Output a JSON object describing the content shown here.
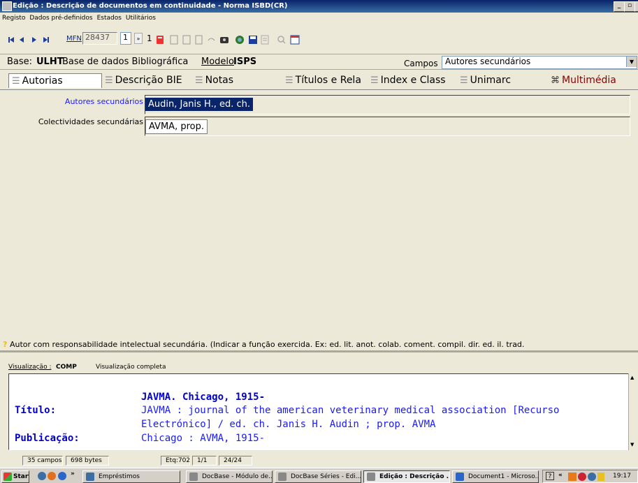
{
  "window": {
    "title": "Edição : Descrição de documentos em continuidade - Norma ISBD(CR)"
  },
  "menu": {
    "items": [
      "Registo",
      "Dados pré-definidos",
      "Estados",
      "Utilitários"
    ]
  },
  "toolbar": {
    "mfn_label": "MFN",
    "mfn_value": "28437",
    "spin_value": "1",
    "page_value": "1"
  },
  "base": {
    "label": "Base:",
    "value": "ULHT",
    "description": "Base de dados Bibliográfica",
    "modelo_label": "Modelo",
    "modelo_value": "ISPS",
    "campos_label": "Campos",
    "campos_value": "Autores secundários"
  },
  "tabs": [
    {
      "label": "Autorias"
    },
    {
      "label": "Descrição BIE"
    },
    {
      "label": "Notas"
    },
    {
      "label": "Títulos e Rela"
    },
    {
      "label": "Index e Class"
    },
    {
      "label": "Unimarc"
    },
    {
      "label": "Multimédia"
    }
  ],
  "fields": [
    {
      "label": "Autores secundários",
      "value": "Audin, Janis H., ed. ch."
    },
    {
      "label": "Colectividades secundárias",
      "value": "AVMA, prop."
    }
  ],
  "hint": {
    "icon": "?",
    "text": "Autor com responsabilidade intelectual secundária. (Indicar a função exercida. Ex: ed. lit.  anot.  colab.  coment.  compil.  dir.  ed.  il.  trad."
  },
  "visualizacao": {
    "label": "Visualização :",
    "code": "COMP",
    "description": "Visualização completa"
  },
  "preview": {
    "heading": "JAVMA. Chicago, 1915-",
    "titulo_label": "Título:",
    "titulo_line1": "JAVMA : journal of the american veterinary medical association [Recurso",
    "titulo_line2": "Electrónico] / ed. ch. Janis H. Audin ; prop. AVMA",
    "publicacao_label": "Publicação:",
    "publicacao_value": "Chicago : AVMA, 1915-"
  },
  "status": {
    "campos": "35 campos",
    "bytes": "698 bytes",
    "etq": "Etq:702",
    "page": "1/1",
    "count": "24/24"
  },
  "taskbar": {
    "start": "Start",
    "chevron": "»",
    "items": [
      "Empréstimos",
      "DocBase - Módulo de...",
      "DocBase Séries - Edi...",
      "Edição : Descrição ...",
      "Document1 - Microso..."
    ],
    "tray_chevron": "«",
    "clock": "19:17"
  },
  "window_buttons": {
    "minimize": "_",
    "restore": "▫",
    "close": "×"
  }
}
